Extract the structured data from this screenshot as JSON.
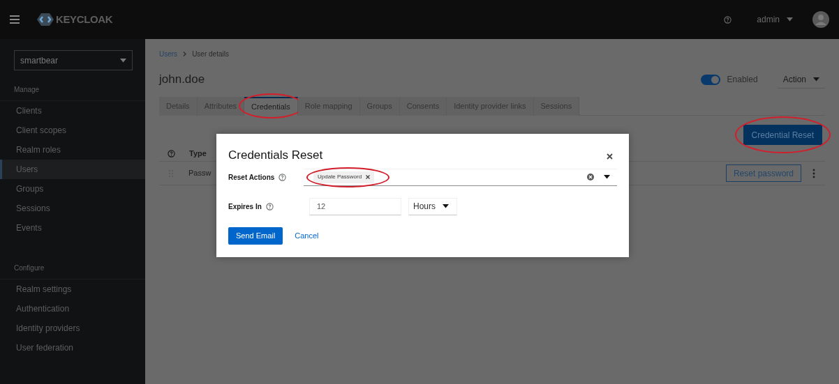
{
  "header": {
    "logo": "KEYCLOAK",
    "user": "admin"
  },
  "sidebar": {
    "realm": "smartbear",
    "sections": [
      {
        "title": "Manage",
        "items": [
          {
            "label": "Clients",
            "selected": false
          },
          {
            "label": "Client scopes",
            "selected": false
          },
          {
            "label": "Realm roles",
            "selected": false
          },
          {
            "label": "Users",
            "selected": true
          },
          {
            "label": "Groups",
            "selected": false
          },
          {
            "label": "Sessions",
            "selected": false
          },
          {
            "label": "Events",
            "selected": false
          }
        ]
      },
      {
        "title": "Configure",
        "items": [
          {
            "label": "Realm settings",
            "selected": false
          },
          {
            "label": "Authentication",
            "selected": false
          },
          {
            "label": "Identity providers",
            "selected": false
          },
          {
            "label": "User federation",
            "selected": false
          }
        ]
      }
    ]
  },
  "breadcrumb": [
    "Users",
    "User details"
  ],
  "title": "john.doe",
  "enabled": {
    "label": "Enabled",
    "on": true
  },
  "action": "Action",
  "tabs": [
    {
      "label": "Details",
      "selected": false,
      "annotated": false
    },
    {
      "label": "Attributes",
      "selected": false,
      "annotated": false
    },
    {
      "label": "Credentials",
      "selected": true,
      "annotated": true
    },
    {
      "label": "Role mapping",
      "selected": false,
      "annotated": false
    },
    {
      "label": "Groups",
      "selected": false,
      "annotated": false
    },
    {
      "label": "Consents",
      "selected": false,
      "annotated": false
    },
    {
      "label": "Identity provider links",
      "selected": false,
      "annotated": false
    },
    {
      "label": "Sessions",
      "selected": false,
      "annotated": false
    }
  ],
  "credential_reset": {
    "label": "Credential Reset",
    "annotated": true
  },
  "table": {
    "columns": [
      "Type"
    ],
    "rows": [
      {
        "type": "Passw",
        "action": "Reset password"
      }
    ]
  },
  "dialog": {
    "title": "Credentials Reset",
    "reset_actions": {
      "label": "Reset Actions",
      "chips": [
        {
          "label": "Update Password",
          "annotated": true
        }
      ]
    },
    "expires": {
      "label": "Expires In",
      "value": "12",
      "unit": "Hours"
    },
    "send": "Send Email",
    "cancel": "Cancel"
  }
}
